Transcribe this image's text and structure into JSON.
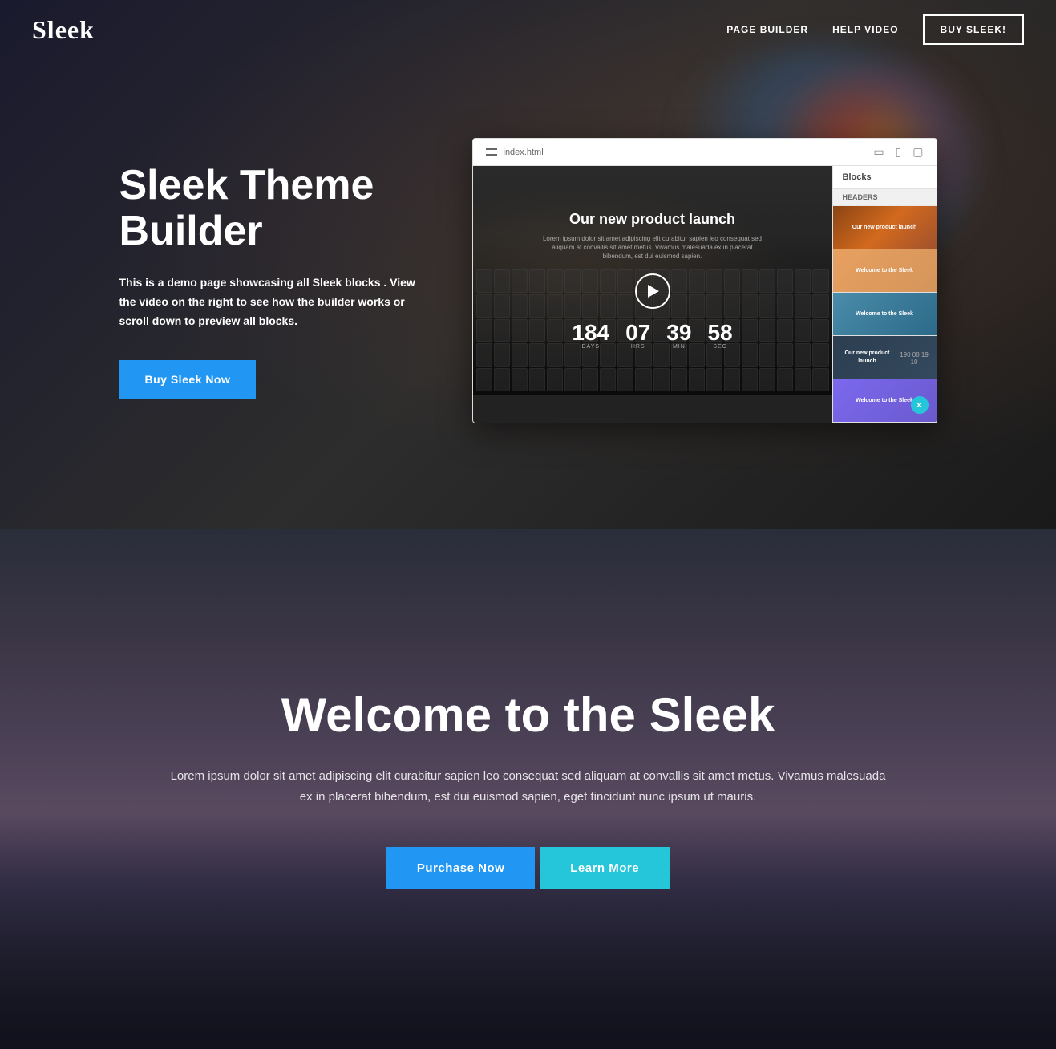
{
  "nav": {
    "logo": "Sleek",
    "links": [
      {
        "id": "page-builder",
        "label": "PAGE BUILDER"
      },
      {
        "id": "help-video",
        "label": "HELP VIDEO"
      }
    ],
    "cta_button": "BUY SLEEK!"
  },
  "hero": {
    "title": "Sleek Theme Builder",
    "description": "This is a demo page showcasing all Sleek blocks . View the video on the right to see how the builder works or scroll down to preview all blocks.",
    "cta_button": "Buy Sleek Now",
    "builder": {
      "filename": "index.html",
      "blocks_label": "Blocks",
      "headers_label": "HEADERS",
      "inner_title": "Our new product launch",
      "inner_text": "Lorem ipsum dolor sit amet adipiscing elit curabitur sapien leo consequat sed aliquam at convallis sit amet metus. Vivamus malesuada ex in placerat bibendum, est dui euismod sapien.",
      "countdown": [
        {
          "num": "184",
          "label": "DAYS"
        },
        {
          "num": "07",
          "label": "HRS"
        },
        {
          "num": "39",
          "label": "MIN"
        },
        {
          "num": "58",
          "label": "SEC"
        }
      ],
      "close_icon": "×",
      "mini_countdown": "190 08 19 10"
    }
  },
  "welcome": {
    "title": "Welcome to the Sleek",
    "description": "Lorem ipsum dolor sit amet adipiscing elit curabitur sapien leo consequat sed aliquam at convallis sit amet metus. Vivamus malesuada ex in placerat bibendum, est dui euismod sapien, eget tincidunt nunc ipsum ut mauris.",
    "purchase_button": "Purchase Now",
    "learn_button": "Learn More"
  },
  "colors": {
    "accent_blue": "#2196F3",
    "accent_cyan": "#26C6DA",
    "nav_border": "#fff",
    "hero_bg": "#2a2a2a",
    "welcome_bg": "#2a3040"
  }
}
